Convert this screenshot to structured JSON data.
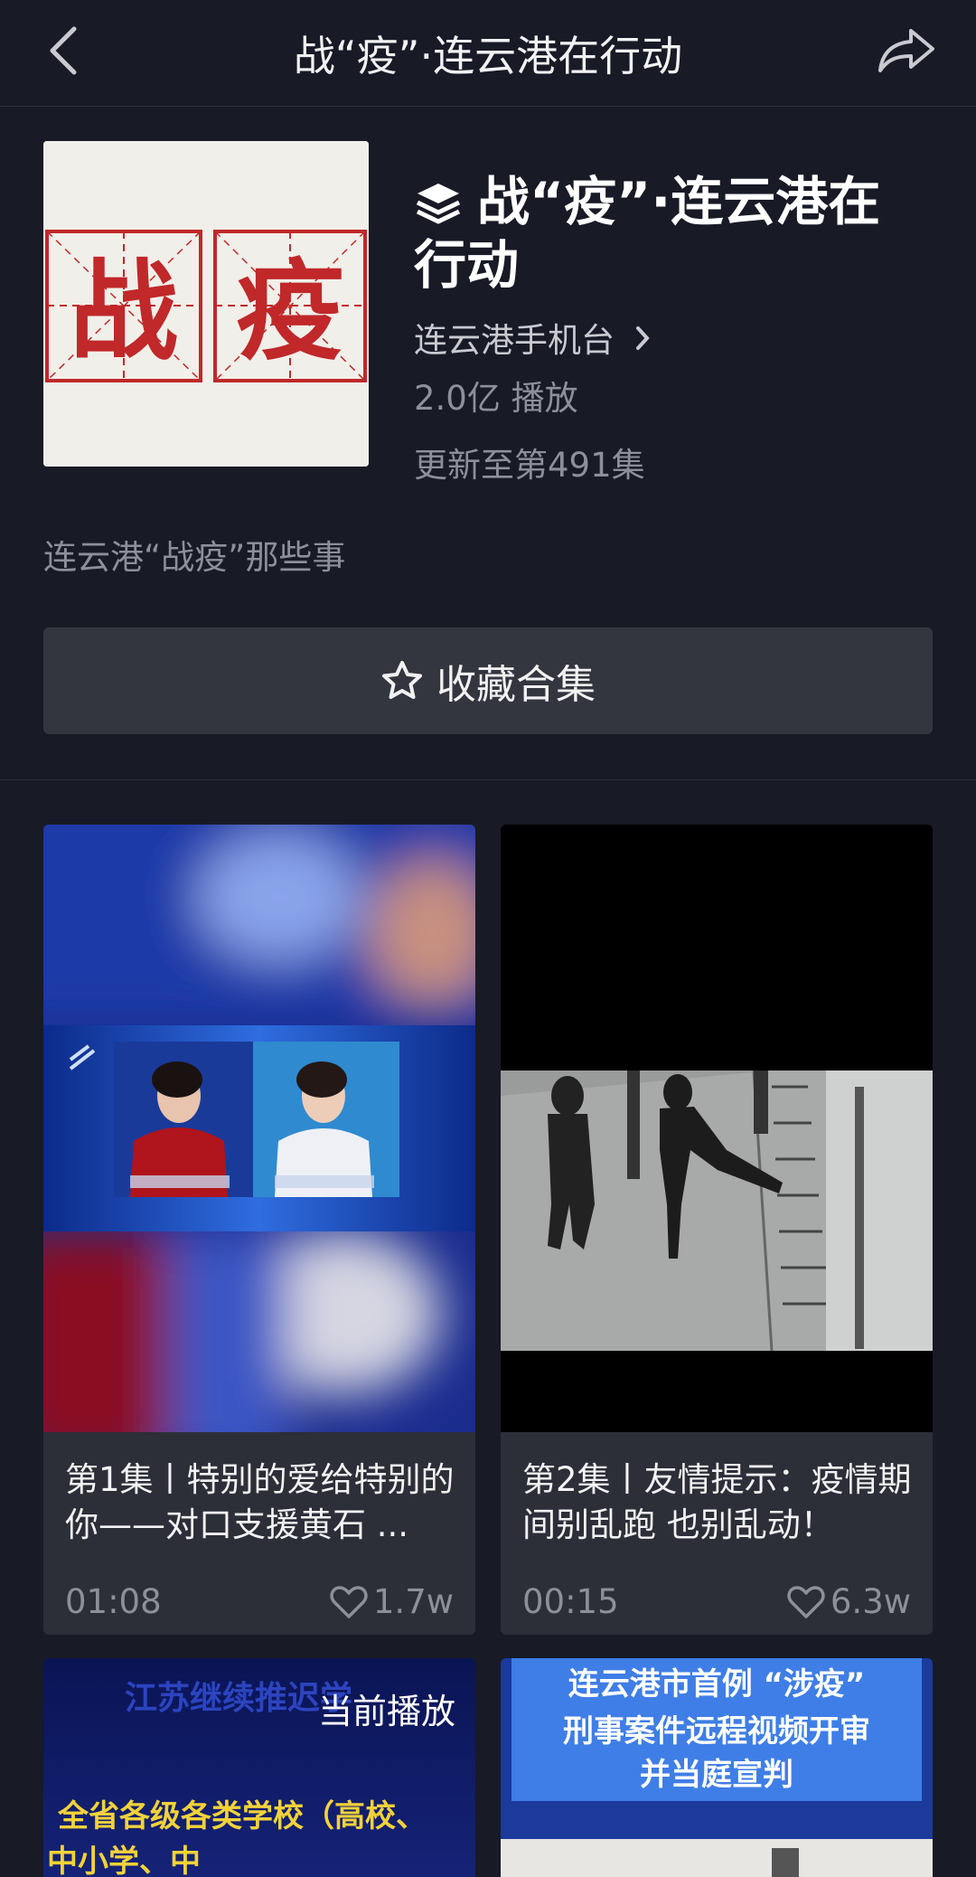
{
  "topbar": {
    "title": "战“疫”·连云港在行动",
    "back_icon": "chevron-left-icon",
    "share_icon": "share-arrow-icon"
  },
  "collection": {
    "cover_chars": [
      "战",
      "疫"
    ],
    "title": "战“疫”·连云港在行动",
    "author": "连云港手机台",
    "plays": "2.0亿 播放",
    "updates": "更新至第491集",
    "description": "连云港“战疫”那些事",
    "favorite_label": "收藏合集"
  },
  "episodes": [
    {
      "title": "第1集丨特别的爱给特别的你——对口支援黄石 ...",
      "duration": "01:08",
      "likes": "1.7w"
    },
    {
      "title": "第2集丨友情提示：疫情期间别乱跑 也别乱动！",
      "duration": "00:15",
      "likes": "6.3w"
    },
    {
      "badge": "当前播放",
      "overlay_top": "江苏继续推迟学",
      "overlay_lines": [
        "全省各级各类学校（高校、",
        "中小学、中"
      ]
    },
    {
      "overlay_lines": [
        "连云港市首例 “涉疫”",
        "刑事案件远程视频开审",
        "并当庭宣判"
      ]
    }
  ],
  "colors": {
    "background": "#181a26",
    "card": "#2c2e38",
    "button": "#34363f",
    "muted_text": "#8d8f99"
  }
}
